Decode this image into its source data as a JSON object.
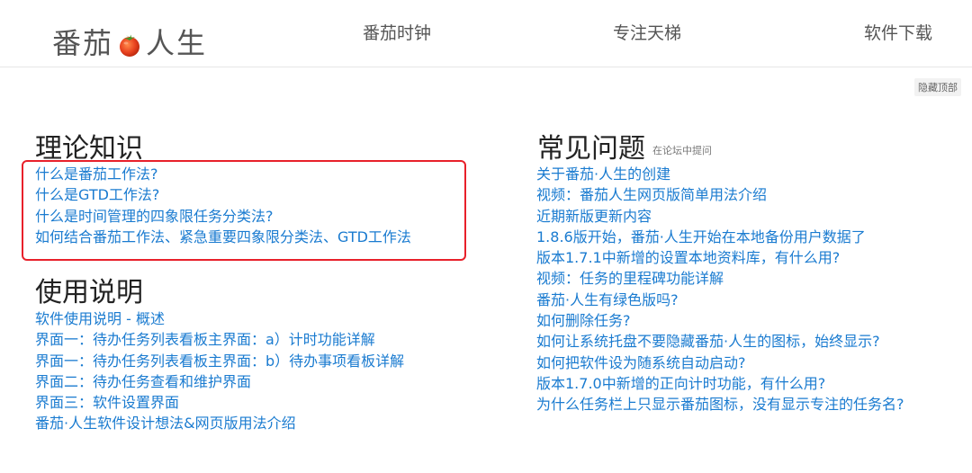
{
  "header": {
    "logo_left": "番茄",
    "logo_right": "人生",
    "nav": [
      "番茄时钟",
      "专注天梯",
      "软件下载"
    ]
  },
  "hide_top_label": "隐藏顶部",
  "theory": {
    "title": "理论知识",
    "links": [
      "什么是番茄工作法?",
      "什么是GTD工作法?",
      "什么是时间管理的四象限任务分类法?",
      "如何结合番茄工作法、紧急重要四象限分类法、GTD工作法"
    ]
  },
  "usage": {
    "title": "使用说明",
    "links": [
      "软件使用说明 - 概述",
      "界面一：待办任务列表看板主界面：a）计时功能详解",
      "界面一：待办任务列表看板主界面：b）待办事项看板详解",
      "界面二：待办任务查看和维护界面",
      "界面三：软件设置界面",
      "番茄·人生软件设计想法&网页版用法介绍"
    ]
  },
  "faq": {
    "title": "常见问题",
    "hint": "在论坛中提问",
    "links": [
      "关于番茄·人生的创建",
      "视频：番茄人生网页版简单用法介绍",
      "近期新版更新内容",
      "1.8.6版开始，番茄·人生开始在本地备份用户数据了",
      "版本1.7.1中新增的设置本地资料库，有什么用?",
      "视频：任务的里程碑功能详解",
      "番茄·人生有绿色版吗?",
      "如何删除任务?",
      "如何让系统托盘不要隐藏番茄·人生的图标，始终显示?",
      "如何把软件设为随系统自动启动?",
      "版本1.7.0中新增的正向计时功能，有什么用?",
      "为什么任务栏上只显示番茄图标，没有显示专注的任务名?"
    ]
  },
  "colors": {
    "link": "#1a7bd0",
    "highlight": "#e8202a",
    "tomato": "#e8421f",
    "leaf": "#3a9a2a"
  },
  "icons": {
    "logo": "tomato-icon"
  }
}
